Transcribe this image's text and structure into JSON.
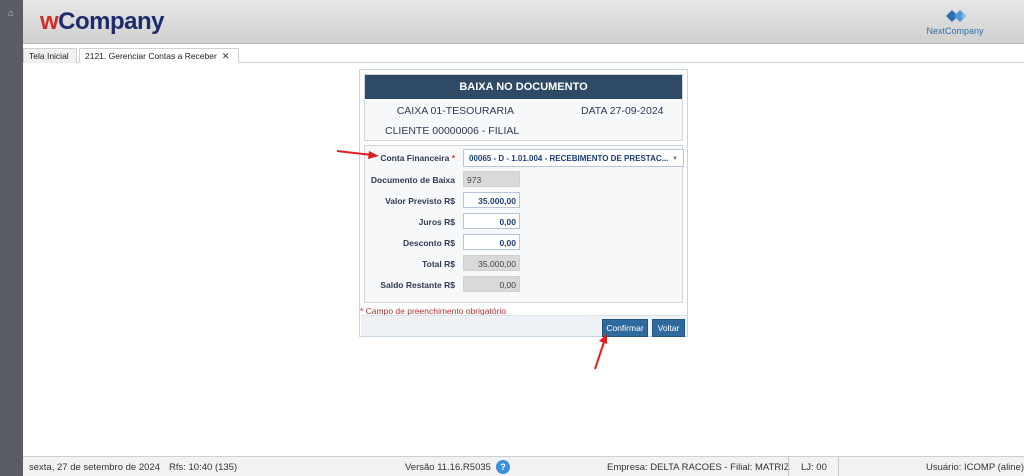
{
  "header": {
    "logo_w": "w",
    "logo_company": "Company",
    "partner_logo": "NextCompany"
  },
  "tabs": [
    {
      "label": "Tela Inicial"
    },
    {
      "label": "2121. Gerenciar Contas a Receber",
      "close": "✕"
    }
  ],
  "modal": {
    "title": "BAIXA NO DOCUMENTO",
    "caixa": "CAIXA  01-TESOURARIA",
    "data": "DATA  27-09-2024",
    "cliente": "CLIENTE  00000006 - FILIAL",
    "fields": {
      "conta_label": "Conta Financeira",
      "conta_required": "*",
      "conta_value": "00065 - D - 1.01.004 - RECEBIMENTO DE PRESTAC...",
      "documento_label": "Documento de Baixa",
      "documento_value": "973",
      "valor_previsto_label": "Valor Previsto R$",
      "valor_previsto_value": "35.000,00",
      "juros_label": "Juros R$",
      "juros_value": "0,00",
      "desconto_label": "Desconto R$",
      "desconto_value": "0,00",
      "total_label": "Total R$",
      "total_value": "35.000,00",
      "saldo_label": "Saldo Restante R$",
      "saldo_value": "0,00"
    },
    "required_note": "* Campo de preenchimento obrigatório",
    "confirm_button": "Confirmar",
    "back_button": "Voltar"
  },
  "status_bar": {
    "date": "sexta, 27 de setembro de 2024",
    "rfs": "Rfs: 10:40 (135)",
    "version": "Versão 11.16.R5035",
    "help": "?",
    "empresa": "Empresa: DELTA RACOES - Filial: MATRIZ",
    "lj": "LJ: 00",
    "usuario": "Usuário: ICOMP (aline)"
  },
  "icons": [
    "home-icon",
    "help-icon",
    "dropdown-caret-icon",
    "close-icon"
  ],
  "colors": {
    "title_bar": "#2f4a64",
    "button": "#2f6a9e",
    "annotation_arrow": "#e02020",
    "required": "#c0392b"
  }
}
